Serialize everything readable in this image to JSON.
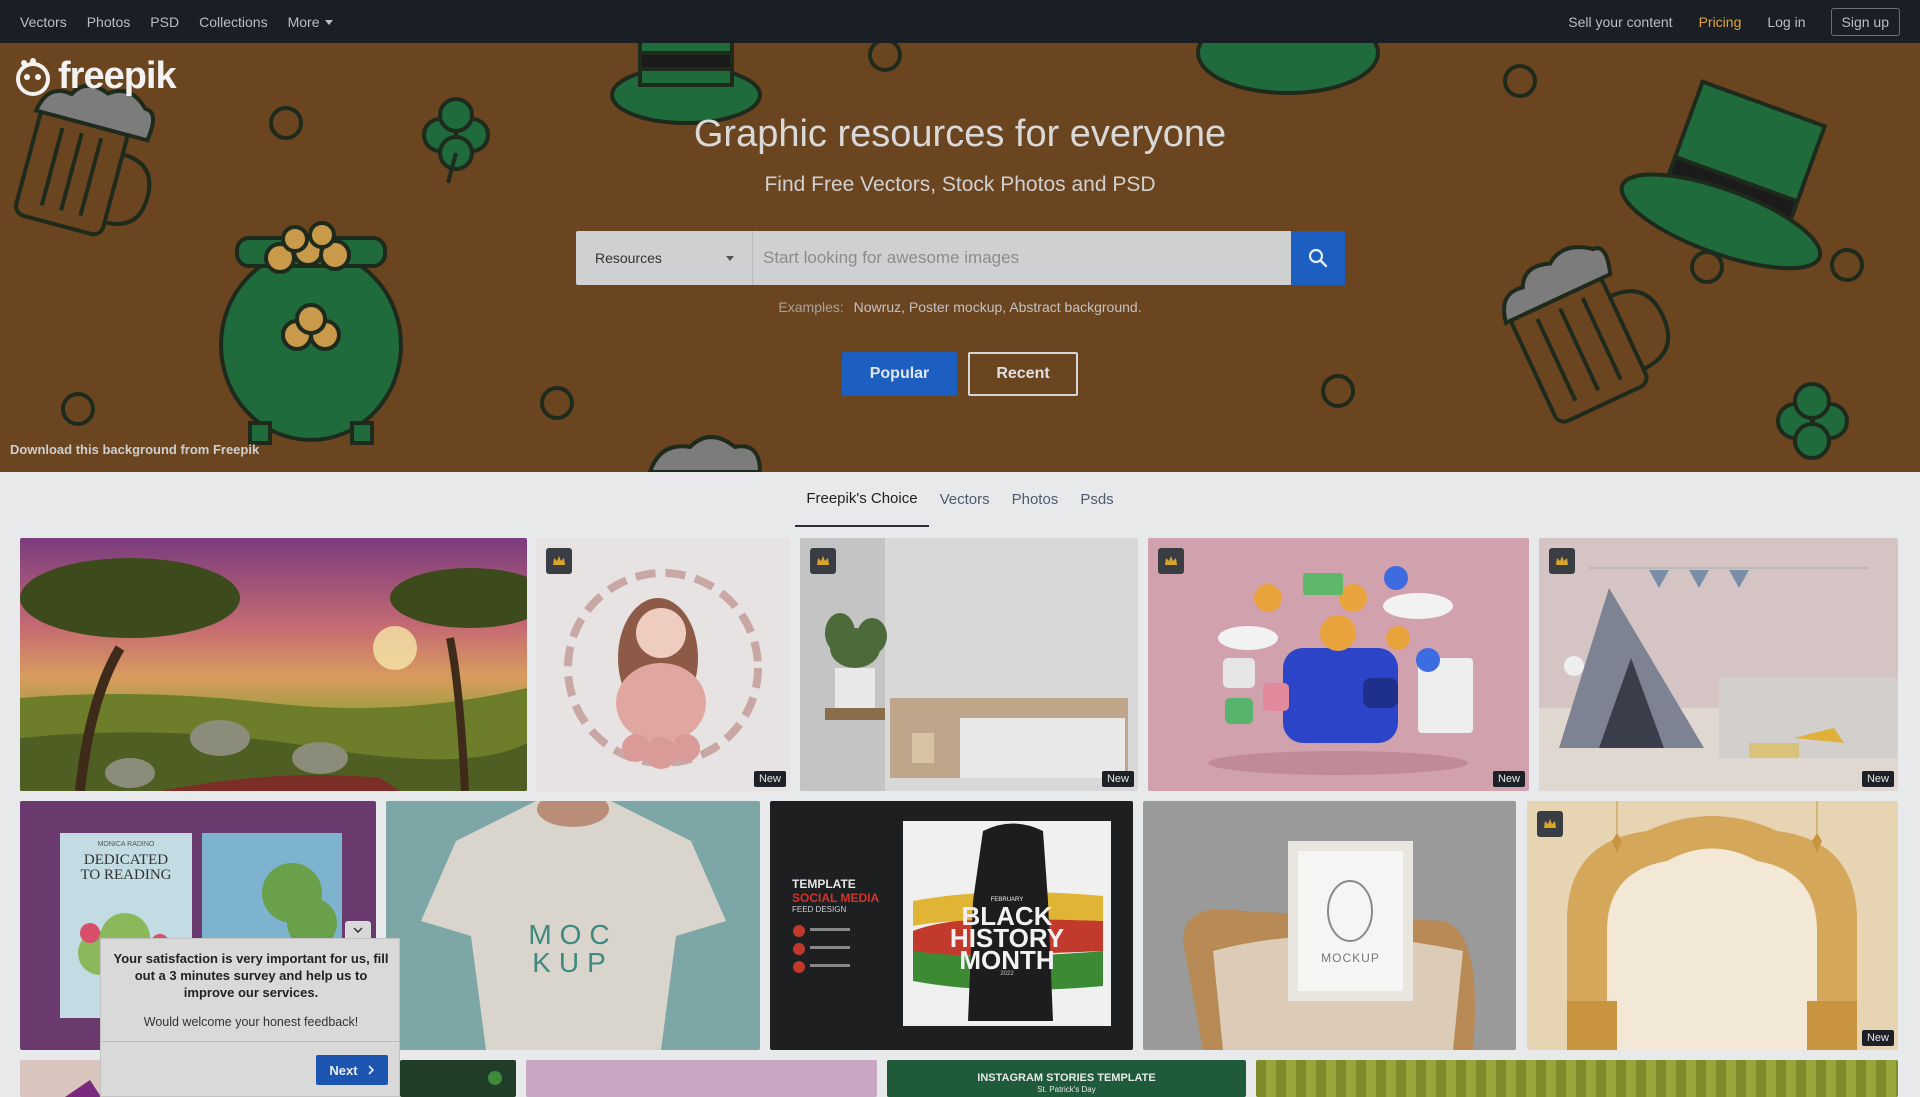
{
  "nav": {
    "left": [
      "Vectors",
      "Photos",
      "PSD",
      "Collections",
      "More"
    ],
    "right": {
      "sell": "Sell your content",
      "pricing": "Pricing",
      "login": "Log in",
      "signup": "Sign up"
    }
  },
  "hero": {
    "logo": "freepik",
    "title": "Graphic resources for everyone",
    "subtitle": "Find Free Vectors, Stock Photos and PSD",
    "search": {
      "type_selected": "Resources",
      "placeholder": "Start looking for awesome images"
    },
    "examples_label": "Examples:",
    "examples": [
      "Nowruz,",
      "Poster mockup,",
      "Abstract background."
    ],
    "btn_popular": "Popular",
    "btn_recent": "Recent",
    "bg_credit": "Download this background from Freepik"
  },
  "tabs": [
    "Freepik's Choice",
    "Vectors",
    "Photos",
    "Psds"
  ],
  "tiles": {
    "new_label": "New",
    "mockup_shirt": "MOC\nKUP",
    "book_title": "DEDICATED\nTO READING",
    "book_author": "MONICA RADINO",
    "bhm_template": "TEMPLATE",
    "bhm_social": "SOCIAL MEDIA",
    "bhm_feed": "FEED DESIGN",
    "bhm_month_label": "FEBRUARY",
    "bhm_title_1": "BLACK",
    "bhm_title_2": "HISTORY",
    "bhm_title_3": "MONTH",
    "bhm_year": "2022",
    "frame_label": "MOCKUP",
    "insta_title": "INSTAGRAM STORIES TEMPLATE",
    "insta_sub": "St. Patrick's Day"
  },
  "survey": {
    "text": "Your satisfaction is very important for us, fill out a 3 minutes survey and help us to improve our services.",
    "sub": "Would welcome your honest feedback!",
    "next": "Next"
  },
  "colors": {
    "accent_blue": "#1c5fc0",
    "pricing": "#e2a33c",
    "hero_bg": "#6b4520",
    "nav_bg": "#1a1f26"
  }
}
